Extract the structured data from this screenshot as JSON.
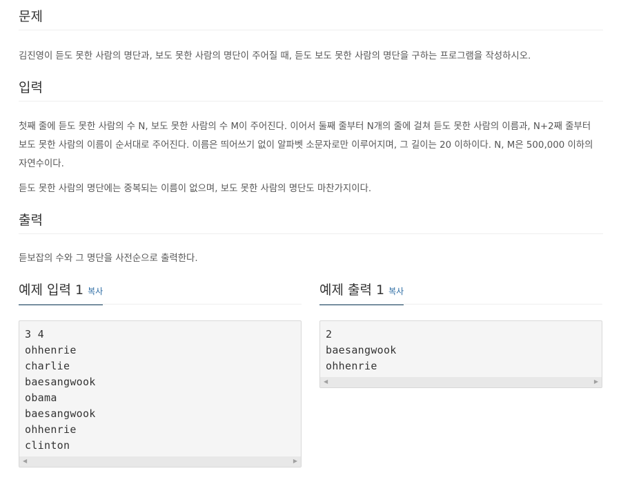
{
  "sections": {
    "problem": {
      "title": "문제",
      "text": "김진영이 듣도 못한 사람의 명단과, 보도 못한 사람의 명단이 주어질 때, 듣도 보도 못한 사람의 명단을 구하는 프로그램을 작성하시오."
    },
    "input": {
      "title": "입력",
      "text1": "첫째 줄에 듣도 못한 사람의 수 N, 보도 못한 사람의 수 M이 주어진다. 이어서 둘째 줄부터 N개의 줄에 걸쳐 듣도 못한 사람의 이름과, N+2째 줄부터 보도 못한 사람의 이름이 순서대로 주어진다. 이름은 띄어쓰기 없이 알파벳 소문자로만 이루어지며, 그 길이는 20 이하이다. N, M은 500,000 이하의 자연수이다.",
      "text2": "듣도 못한 사람의 명단에는 중복되는 이름이 없으며, 보도 못한 사람의 명단도 마찬가지이다."
    },
    "output": {
      "title": "출력",
      "text": "듣보잡의 수와 그 명단을 사전순으로 출력한다."
    }
  },
  "samples": {
    "input": {
      "title": "예제 입력 1",
      "copy_label": "복사",
      "content": "3 4\nohhenrie\ncharlie\nbaesangwook\nobama\nbaesangwook\nohhenrie\nclinton"
    },
    "output": {
      "title": "예제 출력 1",
      "copy_label": "복사",
      "content": "2\nbaesangwook\nohhenrie"
    }
  },
  "icons": {
    "scroll_left": "triangle-left-icon",
    "scroll_right": "triangle-right-icon"
  }
}
